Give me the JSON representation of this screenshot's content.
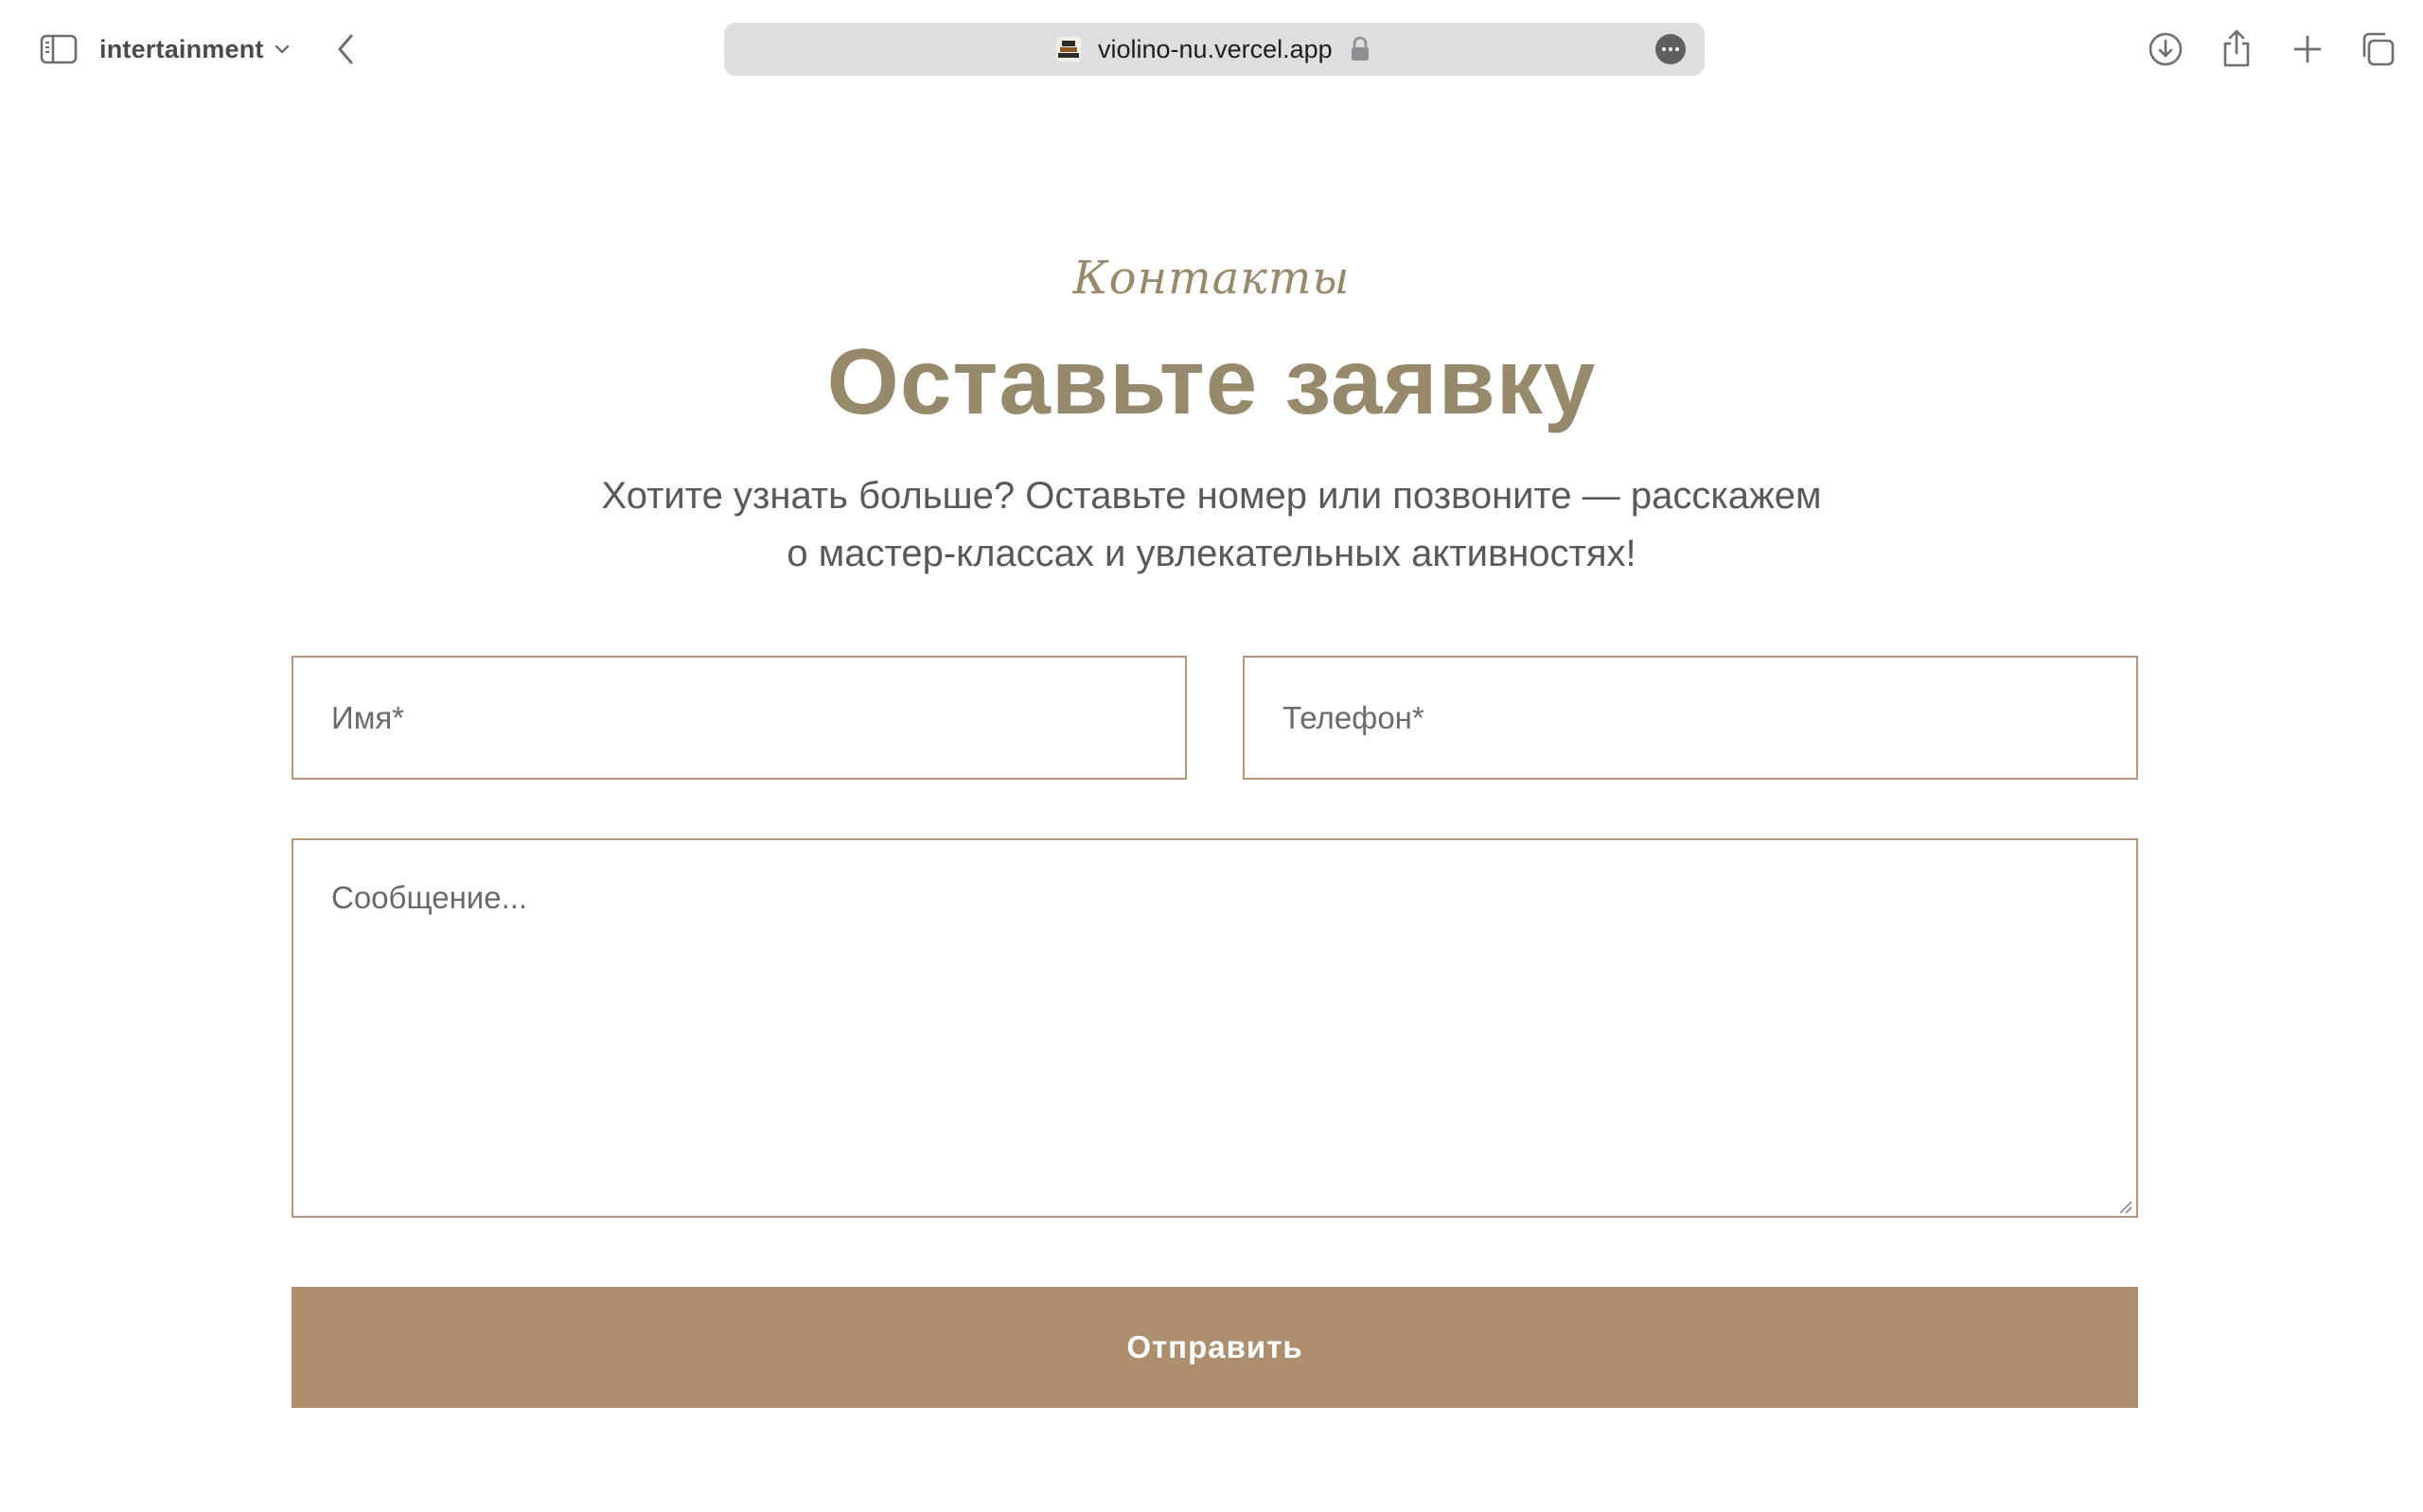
{
  "browser": {
    "group_label": "intertainment",
    "url": "violino-nu.vercel.app"
  },
  "page": {
    "eyebrow": "Контакты",
    "title": "Оставьте заявку",
    "lead_line1": "Хотите узнать больше? Оставьте номер или позвоните — расскажем",
    "lead_line2": "о мастер-классах и увлекательных активностях!"
  },
  "form": {
    "name_placeholder": "Имя*",
    "name_value": "",
    "phone_placeholder": "Телефон*",
    "phone_value": "",
    "message_placeholder": "Сообщение...",
    "message_value": "",
    "submit_label": "Отправить"
  },
  "colors": {
    "accent_text": "#978a6c",
    "field_border": "#b49778",
    "button_bg": "#ad8f70",
    "body_text": "#58595c"
  },
  "icons": [
    "sidebar-icon",
    "chevron-down-icon",
    "back-arrow-icon",
    "favicon-icon",
    "lock-icon",
    "more-icon",
    "download-icon",
    "share-icon",
    "plus-icon",
    "tabs-icon"
  ]
}
